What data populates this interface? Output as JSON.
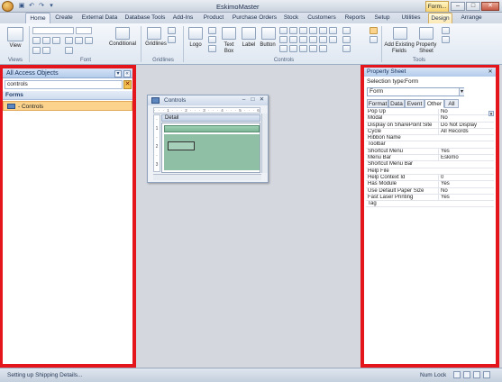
{
  "window": {
    "title": "EskimoMaster",
    "context_tab": "Form...",
    "minimize": "–",
    "maximize": "□",
    "close": "✕"
  },
  "quick_access": [
    "save-icon",
    "undo-icon",
    "redo-icon",
    "customize-icon"
  ],
  "ribbon_tabs": [
    "Home",
    "Create",
    "External Data",
    "Database Tools",
    "Add-Ins",
    "Product",
    "Purchase Orders",
    "Stock",
    "Customers",
    "Reports",
    "Setup",
    "Utilities",
    "Design",
    "Arrange"
  ],
  "ribbon": {
    "views": {
      "view_label": "View",
      "group_label": "Views"
    },
    "font": {
      "group_label": "Font",
      "conditional_label": "Conditional"
    },
    "gridlines": {
      "gridlines_label": "Gridlines",
      "group_label": "Gridlines"
    },
    "controls": {
      "logo_label": "Logo",
      "textbox_label": "Text Box",
      "label_label": "Label",
      "button_label": "Button",
      "group_label": "Controls"
    },
    "tools": {
      "add_fields_label": "Add Existing Fields",
      "property_sheet_label": "Property Sheet",
      "group_label": "Tools"
    }
  },
  "nav_pane": {
    "title": "All Access Objects",
    "search_value": "controls",
    "group": "Forms",
    "item": "- Controls"
  },
  "controls_window": {
    "title": "Controls",
    "ruler": "· · · 1 · · · 2 · · · 3 · · · 4 · · · 5 · · · 6 · · · 7",
    "section": "Detail",
    "vruler": [
      "·",
      "1",
      "·",
      "2",
      "·",
      "3"
    ]
  },
  "property_sheet": {
    "title": "Property Sheet",
    "selection_type_label": "Selection type:",
    "selection_type_value": "Form",
    "selected_object": "Form",
    "tabs": [
      "Format",
      "Data",
      "Event",
      "Other",
      "All"
    ],
    "active_tab": "Other",
    "properties": [
      {
        "name": "Pop Up",
        "value": "No"
      },
      {
        "name": "Modal",
        "value": "No"
      },
      {
        "name": "Display on SharePoint Site",
        "value": "Do Not Display"
      },
      {
        "name": "Cycle",
        "value": "All Records"
      },
      {
        "name": "Ribbon Name",
        "value": ""
      },
      {
        "name": "Toolbar",
        "value": ""
      },
      {
        "name": "Shortcut Menu",
        "value": "Yes"
      },
      {
        "name": "Menu Bar",
        "value": "Eskimo"
      },
      {
        "name": "Shortcut Menu Bar",
        "value": ""
      },
      {
        "name": "Help File",
        "value": ""
      },
      {
        "name": "Help Context Id",
        "value": "0"
      },
      {
        "name": "Has Module",
        "value": "Yes"
      },
      {
        "name": "Use Default Paper Size",
        "value": "No"
      },
      {
        "name": "Fast Laser Printing",
        "value": "Yes"
      },
      {
        "name": "Tag",
        "value": ""
      }
    ]
  },
  "status": {
    "text": "Setting up Shipping Details...",
    "num_lock": "Num Lock"
  },
  "colors": {
    "highlight_border": "#e4151b",
    "selected_item": "#fbd38c"
  }
}
